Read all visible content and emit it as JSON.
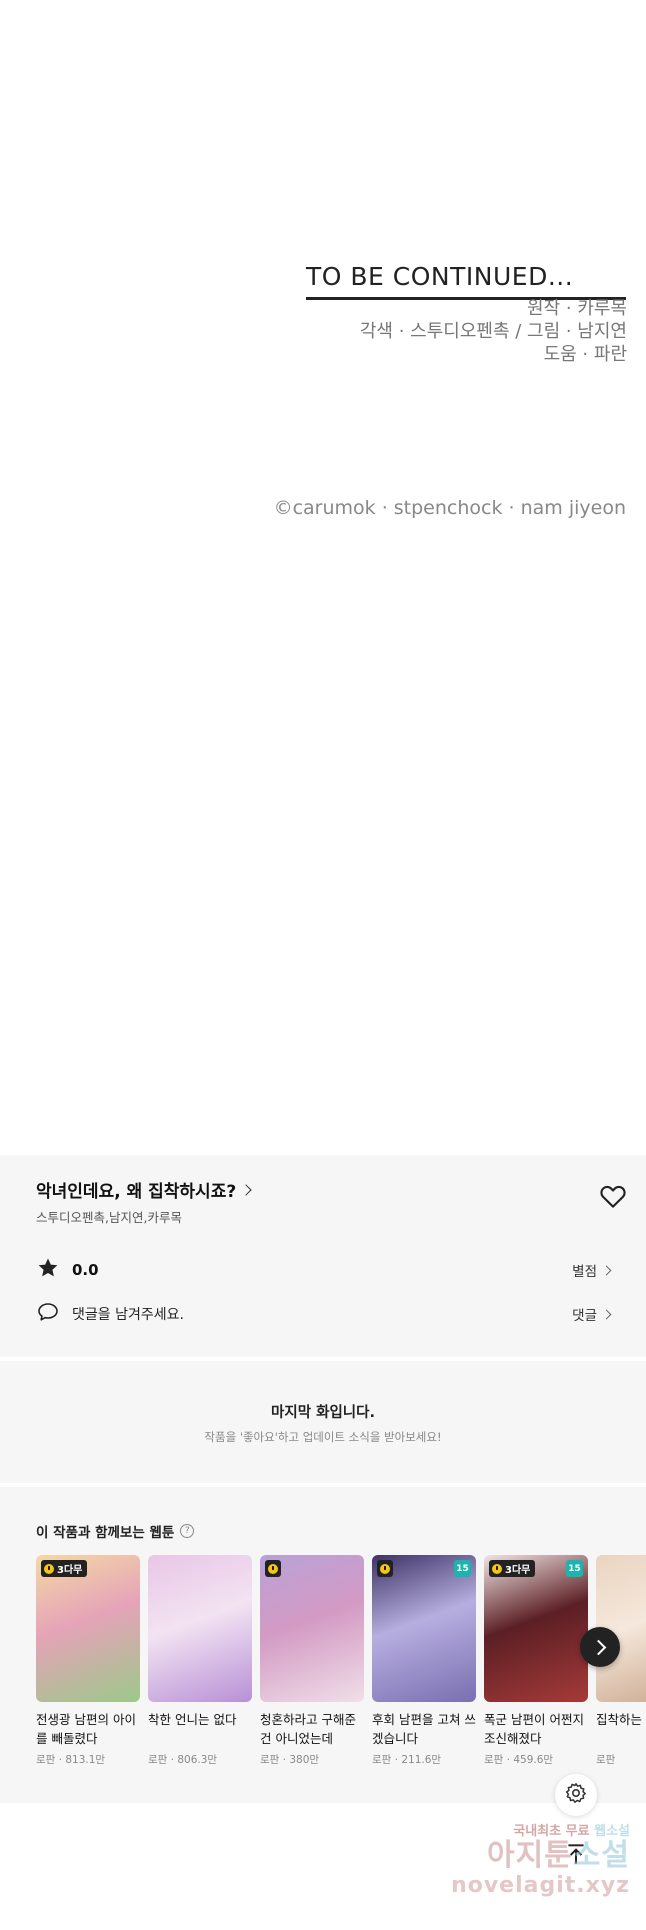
{
  "ending": {
    "to_be_continued": "TO BE CONTINUED...",
    "credits": [
      "원작 · 카루목",
      "각색 · 스투디오펜촉 / 그림 · 남지연",
      "도움 · 파란"
    ],
    "copyright": "©carumok · stpenchock · nam jiyeon"
  },
  "info": {
    "title": "악녀인데요, 왜 집착하시죠?",
    "authors": "스투디오펜촉,남지연,카루목",
    "rating": "0.0",
    "rating_label": "별점",
    "comment_placeholder": "댓글을 남겨주세요.",
    "comment_label": "댓글"
  },
  "last_episode": {
    "title": "마지막 화입니다.",
    "subtitle": "작품을 '좋아요'하고 업데이트 소식을 받아보세요!"
  },
  "recommendations": {
    "header": "이 작품과 함께보는 웹툰",
    "cards": [
      {
        "title": "전생광 남편의 아이를 빼돌렸다",
        "genre": "로판",
        "views": "813.1만",
        "badge": "3다무",
        "age": "",
        "colors": [
          "#f4d9a6",
          "#9cc98a",
          "#e5a3b8"
        ]
      },
      {
        "title": "착한 언니는 없다",
        "genre": "로판",
        "views": "806.3만",
        "badge": "",
        "age": "",
        "colors": [
          "#e9c6e6",
          "#b890d6",
          "#f2e3f2"
        ]
      },
      {
        "title": "청혼하라고 구해준 건 아니었는데",
        "genre": "로판",
        "views": "380만",
        "badge": "",
        "age": "",
        "colors": [
          "#b9a2d8",
          "#f0dfe8",
          "#d39ac4"
        ]
      },
      {
        "title": "후회 남편을 고쳐 쓰겠습니다",
        "genre": "로판",
        "views": "211.6만",
        "badge": "",
        "age": "15",
        "colors": [
          "#3d3366",
          "#7a6fb0",
          "#b7aee0"
        ]
      },
      {
        "title": "폭군 남편이 어쩐지 조신해졌다",
        "genre": "로판",
        "views": "459.6만",
        "badge": "3다무",
        "age": "15",
        "colors": [
          "#f1e4e4",
          "#a63a3a",
          "#5b1f24"
        ]
      },
      {
        "title": "집착하는 직",
        "genre": "로판",
        "views": "",
        "badge": "",
        "age": "",
        "colors": [
          "#ead4c0",
          "#c9a58a",
          "#f5e8dc"
        ]
      }
    ]
  },
  "watermark": {
    "line1_a": "국내최초 무료",
    "line1_b": "웹소설",
    "line2_a": "아지툰",
    "line2_b": "소설",
    "line3": "novelagit.xyz"
  }
}
